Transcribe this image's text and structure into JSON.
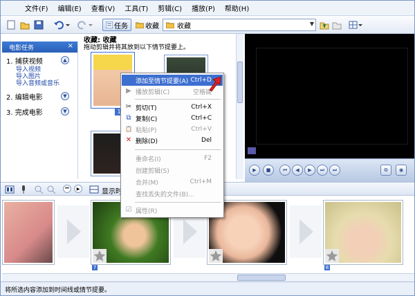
{
  "menubar": {
    "items": [
      "文件(F)",
      "编辑(E)",
      "查看(V)",
      "工具(T)",
      "剪辑(C)",
      "播放(P)",
      "帮助(H)"
    ]
  },
  "toolbar": {
    "task_label": "任务",
    "favorites_label": "收藏",
    "collection_value": "收藏"
  },
  "taskpane": {
    "title": "电影任务",
    "close": "×",
    "sections": [
      {
        "label": "1. 捕获视频",
        "links": [
          "导入视频",
          "导入图片",
          "导入音频或音乐"
        ]
      },
      {
        "label": "2. 编辑电影",
        "links": []
      },
      {
        "label": "3. 完成电影",
        "links": []
      }
    ]
  },
  "collection": {
    "title": "收藏: 收藏",
    "subtitle": "拖动剪辑并将其放到以下情节提要上。",
    "thumb_index": "1"
  },
  "timeline": {
    "show_label": "显示时",
    "frame_numbers": [
      "",
      "7",
      "",
      "8"
    ]
  },
  "context_menu": {
    "items": [
      {
        "label": "添加至情节提要(A)",
        "shortcut": "Ctrl+D",
        "state": "highlight",
        "icon": ""
      },
      {
        "label": "播放剪辑(C)",
        "shortcut": "空格键",
        "state": "disabled",
        "icon": "▶"
      },
      {
        "label": "剪切(T)",
        "shortcut": "Ctrl+X",
        "state": "normal",
        "icon": "✂"
      },
      {
        "label": "复制(C)",
        "shortcut": "Ctrl+C",
        "state": "normal",
        "icon": "⧉"
      },
      {
        "label": "粘贴(P)",
        "shortcut": "Ctrl+V",
        "state": "disabled",
        "icon": "📋"
      },
      {
        "label": "删除(D)",
        "shortcut": "Del",
        "state": "normal",
        "icon": "✕"
      },
      {
        "label": "重命名(I)",
        "shortcut": "F2",
        "state": "disabled",
        "icon": ""
      },
      {
        "label": "创建剪辑(S)",
        "shortcut": "",
        "state": "disabled",
        "icon": ""
      },
      {
        "label": "合并(M)",
        "shortcut": "Ctrl+M",
        "state": "disabled",
        "icon": ""
      },
      {
        "label": "查找丢失的文件(B)...",
        "shortcut": "",
        "state": "disabled",
        "icon": ""
      },
      {
        "label": "属性(R)",
        "shortcut": "",
        "state": "disabled",
        "icon": "☑"
      }
    ]
  },
  "statusbar": {
    "text": "将所选内容添加到时间线或情节提要。"
  },
  "colors": {
    "accent": "#3d6fd0",
    "pane_header": "#2a5fb8",
    "cursor_red": "#e02020"
  }
}
